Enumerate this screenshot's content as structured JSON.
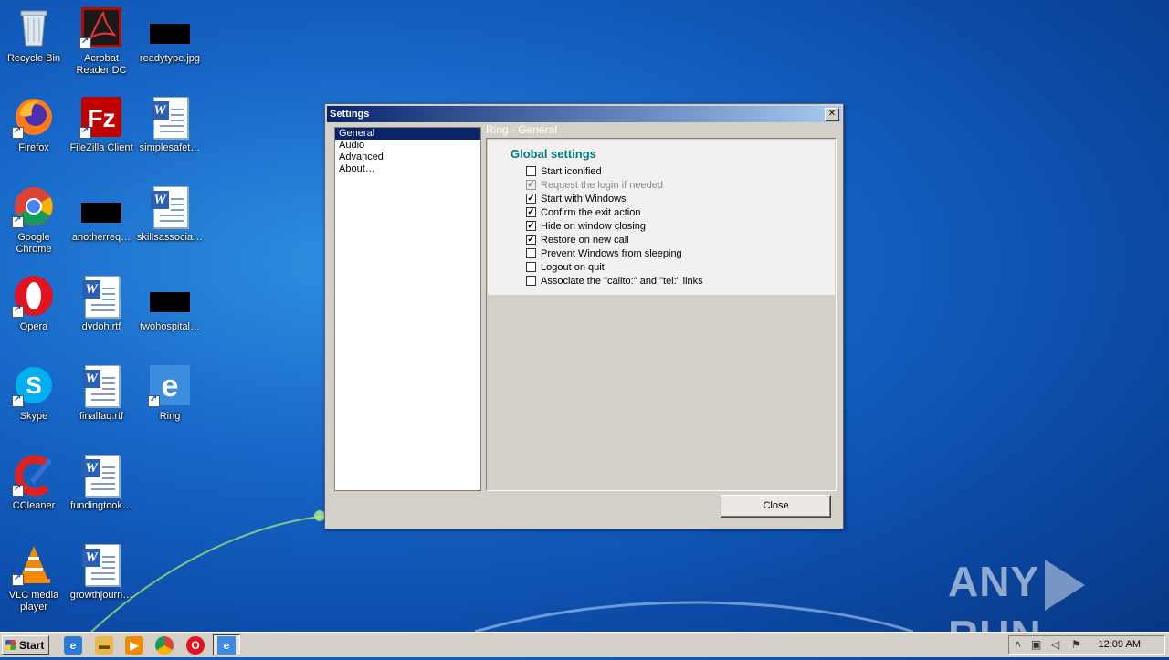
{
  "desktop": {
    "icons": [
      {
        "label": "Recycle Bin",
        "icon": "recycle-bin-icon"
      },
      {
        "label": "Acrobat Reader DC",
        "icon": "acrobat-icon"
      },
      {
        "label": "readytype.jpg",
        "icon": "image-file-icon"
      },
      {
        "label": "Firefox",
        "icon": "firefox-icon"
      },
      {
        "label": "FileZilla Client",
        "icon": "filezilla-icon"
      },
      {
        "label": "simplesafet…",
        "icon": "word-doc-icon"
      },
      {
        "label": "Google Chrome",
        "icon": "chrome-icon"
      },
      {
        "label": "anotherreq…",
        "icon": "image-file-icon"
      },
      {
        "label": "skillsassocia…",
        "icon": "word-doc-icon"
      },
      {
        "label": "Opera",
        "icon": "opera-icon"
      },
      {
        "label": "dvdoh.rtf",
        "icon": "word-doc-icon"
      },
      {
        "label": "twohospital…",
        "icon": "image-file-icon"
      },
      {
        "label": "Skype",
        "icon": "skype-icon"
      },
      {
        "label": "finalfaq.rtf",
        "icon": "word-doc-icon"
      },
      {
        "label": "Ring",
        "icon": "ring-icon"
      },
      {
        "label": "CCleaner",
        "icon": "ccleaner-icon"
      },
      {
        "label": "fundingtook…",
        "icon": "word-doc-icon"
      },
      {
        "label": "VLC media player",
        "icon": "vlc-icon"
      },
      {
        "label": "growthjourn…",
        "icon": "word-doc-icon"
      }
    ]
  },
  "window": {
    "title": "Settings",
    "close_glyph": "✕",
    "nav": [
      {
        "label": "General",
        "selected": true
      },
      {
        "label": "Audio",
        "selected": false
      },
      {
        "label": "Advanced",
        "selected": false
      },
      {
        "label": "About…",
        "selected": false
      }
    ],
    "panel_title": "Ring - General",
    "section_title": "Global settings",
    "options": [
      {
        "label": "Start iconified",
        "checked": false,
        "disabled": false
      },
      {
        "label": "Request the login if needed",
        "checked": true,
        "disabled": true
      },
      {
        "label": "Start with Windows",
        "checked": true,
        "disabled": false
      },
      {
        "label": "Confirm the exit action",
        "checked": true,
        "disabled": false
      },
      {
        "label": "Hide on window closing",
        "checked": true,
        "disabled": false
      },
      {
        "label": "Restore on new call",
        "checked": true,
        "disabled": false
      },
      {
        "label": "Prevent Windows from sleeping",
        "checked": false,
        "disabled": false
      },
      {
        "label": "Logout on quit",
        "checked": false,
        "disabled": false
      },
      {
        "label": "Associate the \"callto:\" and \"tel:\" links",
        "checked": false,
        "disabled": false
      }
    ],
    "close_button": "Close"
  },
  "taskbar": {
    "start_label": "Start",
    "clock": "12:09 AM",
    "apps": [
      "ie-icon",
      "explorer-icon",
      "media-player-icon",
      "chrome-icon",
      "opera-icon",
      "ring-icon"
    ]
  },
  "watermark": {
    "left": "ANY",
    "right": "RUN"
  },
  "colors": {
    "accent": "#0a246a",
    "section_title": "#007a82"
  }
}
